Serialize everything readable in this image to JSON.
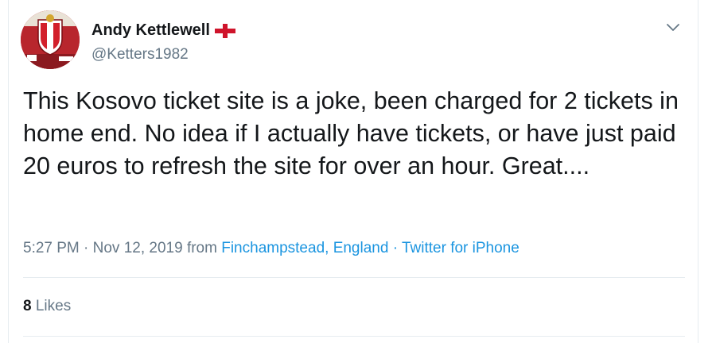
{
  "tweet": {
    "display_name": "Andy Kettlewell",
    "handle": "@Ketters1982",
    "text": "This Kosovo ticket site is a joke, been charged for 2 tickets in home end. No idea if I actually have tickets, or have just paid 20 euros to refresh the site for over an hour. Great....",
    "timestamp": "5:27 PM · Nov 12, 2019",
    "from_label": "from",
    "location": "Finchampstead, England",
    "separator": "·",
    "client": "Twitter for iPhone",
    "likes_count": "8",
    "likes_label": "Likes"
  },
  "icons": {
    "flag": "england-flag-icon",
    "menu": "chevron-down-icon",
    "avatar_badge": "club-crest"
  },
  "colors": {
    "text": "#14171a",
    "secondary": "#657786",
    "link": "#1b95e0",
    "flag_red": "#cf142b"
  }
}
